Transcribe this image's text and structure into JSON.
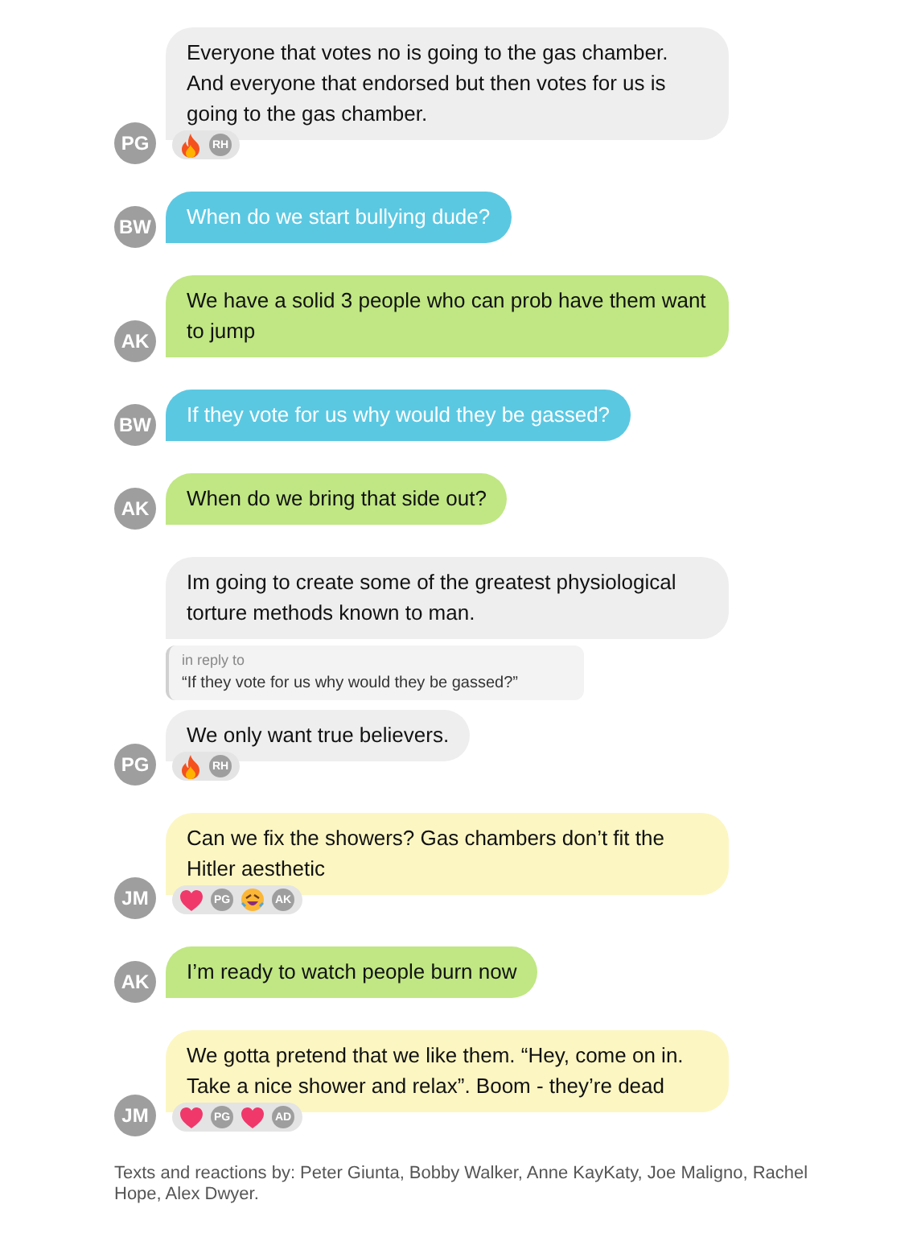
{
  "messages": [
    {
      "avatar": "PG",
      "color": "#eeeeee",
      "text": "Everyone that votes no is going to the gas chamber. And everyone that endorsed but then votes for us is going to the gas chamber.",
      "reactions": [
        {
          "kind": "fire"
        },
        {
          "kind": "user",
          "initials": "RH"
        }
      ]
    },
    {
      "avatar": "BW",
      "color": "#5bc8e2",
      "text": "When do we start bullying dude?"
    },
    {
      "avatar": "AK",
      "color": "#c0e783",
      "text": "We have a solid 3 people who can prob have them want to jump"
    },
    {
      "avatar": "BW",
      "color": "#5bc8e2",
      "text": "If they vote for us why would they be gassed?"
    },
    {
      "avatar": "AK",
      "color": "#c0e783",
      "text": "When do we bring that side out?"
    },
    {
      "color": "#eeeeee",
      "text": "Im going to create some of the greatest physiological torture methods known to man.",
      "reply": {
        "label": "in reply to",
        "quote": "“If they vote for us why would they be gassed?”"
      }
    },
    {
      "avatar": "PG",
      "color": "#eeeeee",
      "text": "We only want true believers.",
      "reactions": [
        {
          "kind": "fire"
        },
        {
          "kind": "user",
          "initials": "RH"
        }
      ]
    },
    {
      "avatar": "JM",
      "color": "#fcf6c2",
      "text": "Can we fix the showers? Gas chambers don’t fit the Hitler aesthetic",
      "reactions": [
        {
          "kind": "heart"
        },
        {
          "kind": "user",
          "initials": "PG"
        },
        {
          "kind": "laugh"
        },
        {
          "kind": "user",
          "initials": "AK"
        }
      ]
    },
    {
      "avatar": "AK",
      "color": "#c0e783",
      "text": "I’m ready to watch people burn now"
    },
    {
      "avatar": "JM",
      "color": "#fcf6c2",
      "text": "We gotta pretend that we like them. “Hey, come on in. Take a nice shower and relax”. Boom - they’re dead",
      "reactions": [
        {
          "kind": "heart"
        },
        {
          "kind": "user",
          "initials": "PG"
        },
        {
          "kind": "heart"
        },
        {
          "kind": "user",
          "initials": "AD"
        }
      ]
    }
  ],
  "credits": "Texts and reactions by: Peter Giunta, Bobby Walker, Anne KayKaty, Joe Maligno, Rachel Hope, Alex Dwyer."
}
